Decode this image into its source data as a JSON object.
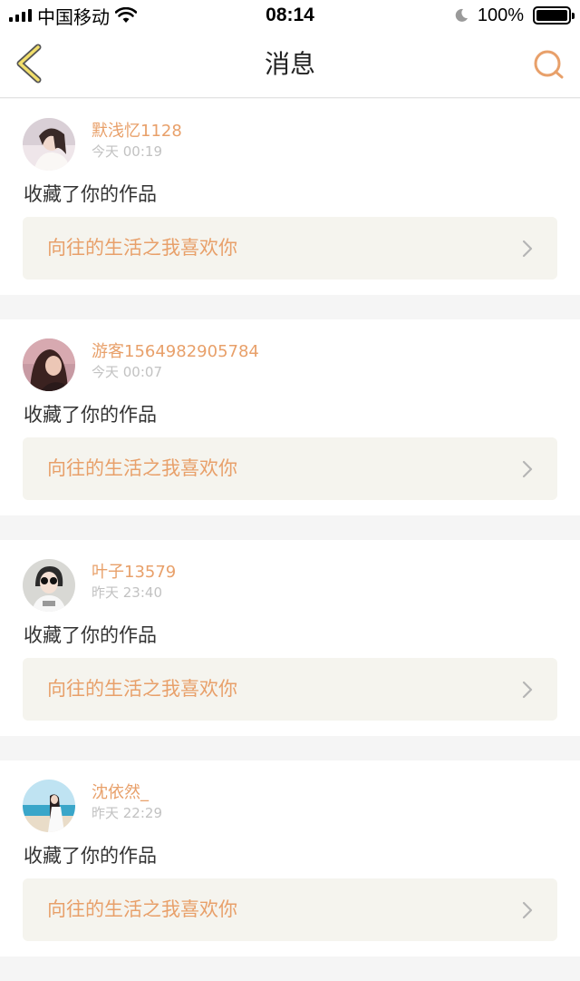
{
  "status_bar": {
    "carrier": "中国移动",
    "time": "08:14",
    "battery_percent": "100%",
    "icons": [
      "signal-icon",
      "wifi-icon",
      "moon-icon",
      "battery-icon"
    ]
  },
  "nav": {
    "title": "消息",
    "back_icon": "back-chevron-icon",
    "search_icon": "search-icon",
    "accent_color": "#e8a06a"
  },
  "messages": [
    {
      "user": "默浅忆1128",
      "time": "今天 00:19",
      "action": "收藏了你的作品",
      "work_title": "向往的生活之我喜欢你"
    },
    {
      "user": "游客1564982905784",
      "time": "今天 00:07",
      "action": "收藏了你的作品",
      "work_title": "向往的生活之我喜欢你"
    },
    {
      "user": "叶子13579",
      "time": "昨天 23:40",
      "action": "收藏了你的作品",
      "work_title": "向往的生活之我喜欢你"
    },
    {
      "user": "沈依然_",
      "time": "昨天 22:29",
      "action": "收藏了你的作品",
      "work_title": "向往的生活之我喜欢你"
    }
  ]
}
